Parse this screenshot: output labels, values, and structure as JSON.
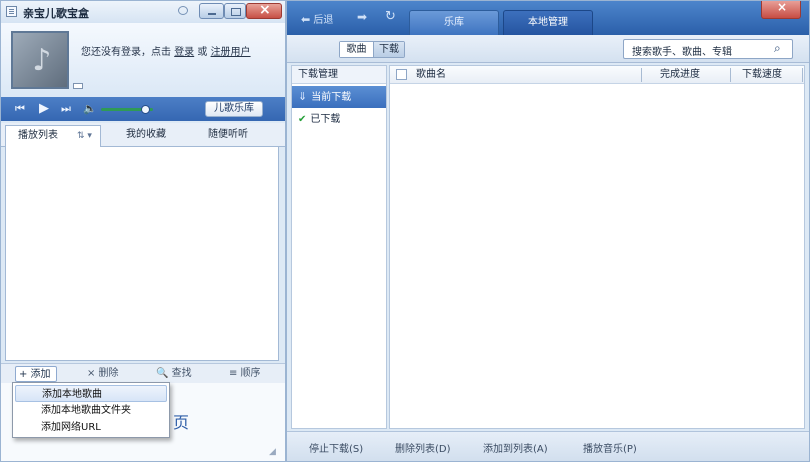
{
  "left_window": {
    "title": "亲宝儿歌宝盒",
    "login_prefix": "您还没有登录，点击",
    "login_link": "登录",
    "login_mid": "或",
    "register_link": "注册用户",
    "kids_library_label": "儿歌乐库",
    "volume_level": 0.85,
    "tabs": [
      {
        "label": "播放列表"
      },
      {
        "label": "我的收藏"
      },
      {
        "label": "随便听听"
      }
    ],
    "sort_icon_label": "⇅ ▾",
    "toolbar": {
      "add": "+ 添加",
      "delete": "× 删除",
      "find": "🔍 查找",
      "order": "≡ 顺序"
    },
    "background_text": "页",
    "popup_menu": [
      {
        "label": "添加本地歌曲"
      },
      {
        "label": "添加本地歌曲文件夹"
      },
      {
        "label": "添加网络URL"
      }
    ]
  },
  "right_window": {
    "nav": {
      "back": "后退"
    },
    "tabs": [
      {
        "label": "乐库"
      },
      {
        "label": "本地管理"
      }
    ],
    "segmented": {
      "songs": "歌曲",
      "downloads": "下载"
    },
    "search": {
      "placeholder": "搜索歌手、歌曲、专辑"
    },
    "sidebar": {
      "header": "下载管理",
      "items": [
        {
          "label": "当前下载"
        },
        {
          "label": "已下载"
        }
      ]
    },
    "table": {
      "columns": [
        "歌曲名",
        "完成进度",
        "下载速度"
      ]
    },
    "bottom_actions": [
      {
        "label": "停止下载(S)"
      },
      {
        "label": "删除列表(D)"
      },
      {
        "label": "添加到列表(A)"
      },
      {
        "label": "播放音乐(P)"
      }
    ]
  },
  "icons": {
    "app": "app-menu-icon",
    "skin": "skin-icon",
    "minimize": "minimize-icon",
    "maximize": "maximize-icon",
    "close": "close-icon",
    "music_note": "music-note-icon",
    "prev": "previous-icon",
    "play": "play-icon",
    "next": "next-icon",
    "volume": "volume-icon",
    "back": "back-arrow-icon",
    "forward": "forward-arrow-icon",
    "refresh": "refresh-icon",
    "search": "search-icon",
    "download": "download-icon",
    "check": "check-icon"
  },
  "colors": {
    "accent_blue": "#3567b2",
    "title_blue": "#2b5fa9",
    "check_green": "#25a038",
    "close_red": "#c75046"
  }
}
